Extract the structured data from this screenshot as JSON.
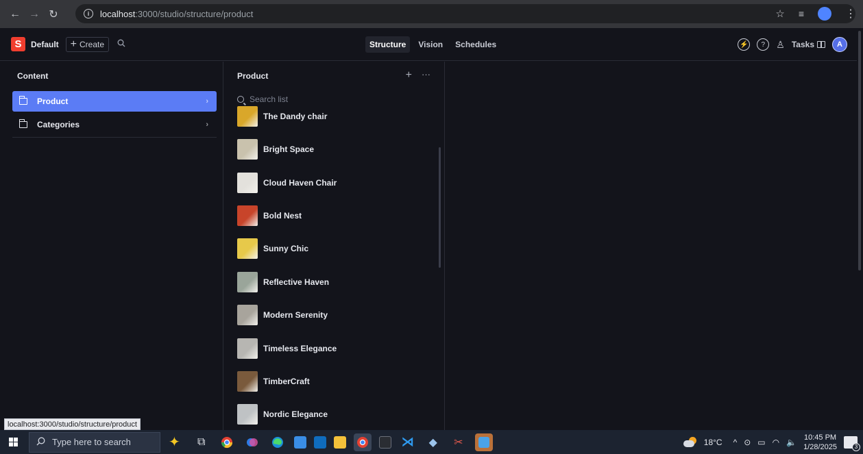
{
  "browser": {
    "url_host": "localhost",
    "url_rest": ":3000/studio/structure/product",
    "status_url": "localhost:3000/studio/structure/product"
  },
  "header": {
    "logo_letter": "S",
    "workspace": "Default",
    "create_label": "Create",
    "tools": [
      "Structure",
      "Vision",
      "Schedules"
    ],
    "active_tool": "Structure",
    "tasks_label": "Tasks",
    "avatar_letter": "A"
  },
  "content_pane": {
    "title": "Content",
    "items": [
      {
        "label": "Product",
        "selected": true
      },
      {
        "label": "Categories",
        "selected": false
      }
    ]
  },
  "product_pane": {
    "title": "Product",
    "search_placeholder": "Search list",
    "documents": [
      {
        "title": "The Dandy chair",
        "thumb_color": "#d9a72a"
      },
      {
        "title": "Bright Space",
        "thumb_color": "#c9c2ad"
      },
      {
        "title": "Cloud Haven Chair",
        "thumb_color": "#e3e1dc"
      },
      {
        "title": "Bold Nest",
        "thumb_color": "#c8442a"
      },
      {
        "title": "Sunny Chic",
        "thumb_color": "#e7c94a"
      },
      {
        "title": "Reflective Haven",
        "thumb_color": "#9aa59a"
      },
      {
        "title": "Modern Serenity",
        "thumb_color": "#a8a49c"
      },
      {
        "title": "Timeless Elegance",
        "thumb_color": "#b7b6b2"
      },
      {
        "title": "TimberCraft",
        "thumb_color": "#7a5a3c"
      },
      {
        "title": "Nordic Elegance",
        "thumb_color": "#bfc2c4"
      }
    ]
  },
  "taskbar": {
    "search_placeholder": "Type here to search",
    "temperature": "18°C",
    "time": "10:45 PM",
    "date": "1/28/2025",
    "notification_count": "3"
  }
}
